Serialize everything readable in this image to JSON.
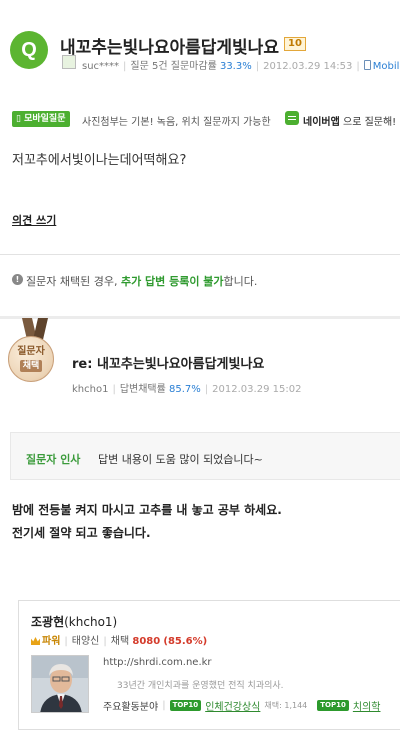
{
  "question": {
    "icon_letter": "Q",
    "title": "내꼬추는빛나요아름답게빛나요",
    "badge": "10",
    "author": "suc****",
    "questions": "질문 5건",
    "close_rate_label": "질문마감률",
    "close_rate": "33.3%",
    "date": "2012.03.29 14:53",
    "mobile_label": "Mobile",
    "body": "저꼬추에서빛이나는데어떡해요?"
  },
  "mobile_notice": {
    "badge": "모바일질문",
    "text": "사진첨부는 기본! 녹음, 위치 질문까지 가능한",
    "app_name": "네이버앱",
    "app_suffix": "으로 질문해!"
  },
  "opinion_link": "의견 쓰기",
  "info": {
    "icon": "!",
    "prefix": "질문자 채택된 경우,",
    "highlight": "추가 답변 등록이 불가",
    "suffix": "합니다."
  },
  "answer": {
    "medal_line1": "질문자",
    "medal_line2": "채택",
    "title": "re: 내꼬추는빛나요아름답게빛나요",
    "author": "khcho1",
    "adopt_label": "답변채택률",
    "adopt_rate": "85.7%",
    "date": "2012.03.29 15:02",
    "thanks_label": "질문자 인사",
    "thanks_text": "답변 내용이 도움 많이 되었습니다~",
    "body_line1": "밤에 전등불 켜지 마시고 고추를 내 놓고 공부 하세요.",
    "body_line2": "전기세 절약 되고 좋습니다."
  },
  "profile": {
    "name": "조광현",
    "id": "(khcho1)",
    "power_label": "파워",
    "level": "태양신",
    "adopt_label": "채택",
    "adopt_count": "8080",
    "adopt_rate": "(85.6%)",
    "url": "http://shrdi.com.ne.kr",
    "desc": "33년간 개인치과를 운영했던 전직 치과의사.",
    "field_label": "주요활동분야",
    "top10_label": "TOP10",
    "category1": "인체건강상식",
    "category1_count": "채택: 1,144",
    "category2": "치의학"
  },
  "colors": {
    "green": "#5cb531",
    "blue": "#2a7fd4",
    "red": "#d43b2b",
    "medal": "#b08057"
  }
}
